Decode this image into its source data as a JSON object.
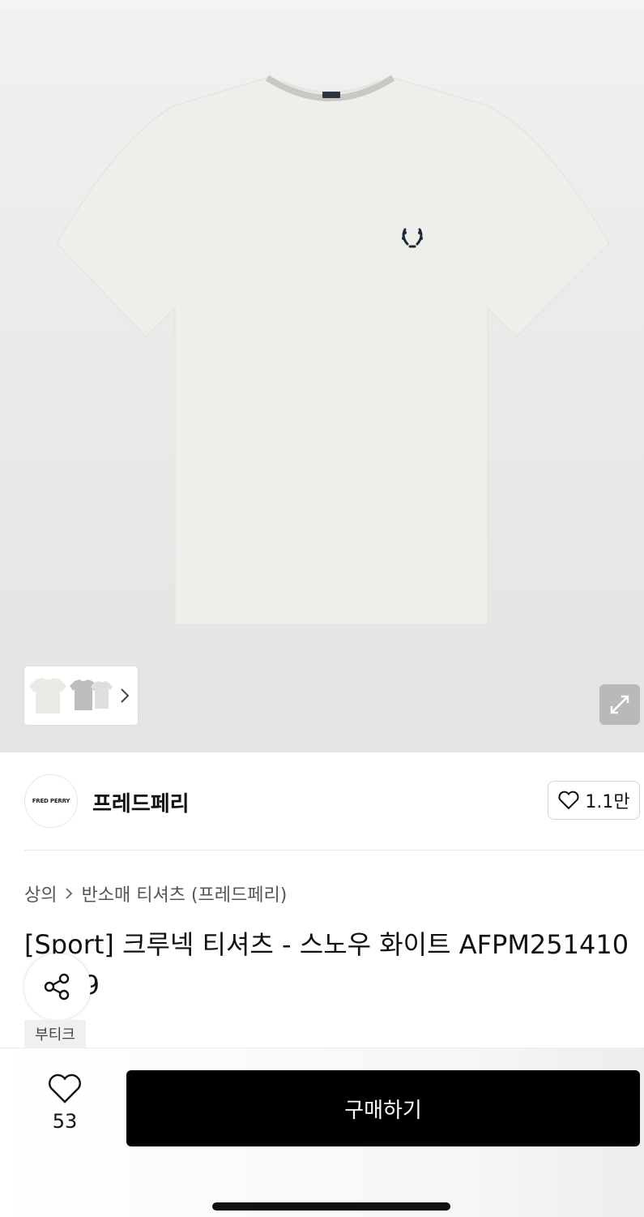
{
  "brand": {
    "logo_text": "FRED PERRY",
    "name": "프레드페리",
    "likes": "1.1만"
  },
  "breadcrumb": {
    "category": "상의",
    "subcategory": "반소매 티셔츠 (프레드페리)"
  },
  "product": {
    "title": "[Sport] 크루넥 티셔츠 - 스노우 화이트 AFPM2514100-129",
    "tag": "부티크"
  },
  "bottom_bar": {
    "wish_count": "53",
    "buy_label": "구매하기"
  },
  "colors": {
    "buy_button": "#000000",
    "shirt": "#eeeeea",
    "logo": "#1c2a3a"
  },
  "icons": [
    "chevron-right-icon",
    "expand-icon",
    "heart-icon",
    "share-icon"
  ]
}
